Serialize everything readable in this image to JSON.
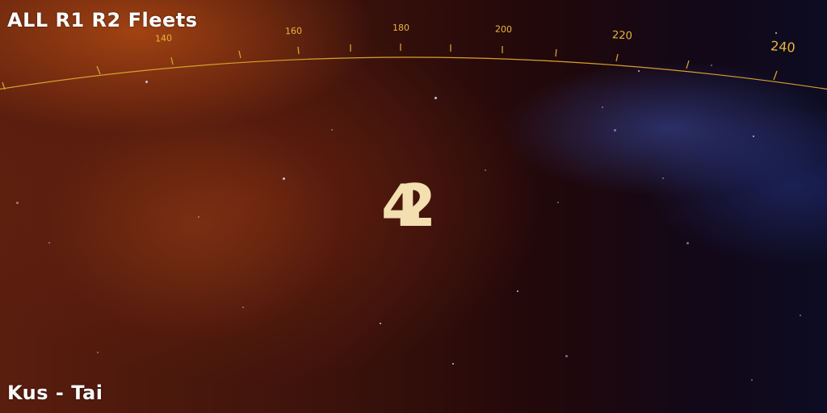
{
  "hud": {
    "fleet_title": "ALL R1  R2 Fleets",
    "location": "Kus - Tai"
  },
  "compass": {
    "headings": [
      "140",
      "160",
      "180",
      "200",
      "220",
      "240"
    ],
    "highlight_heading": "240",
    "color": "#e8b53a"
  },
  "fleet_marker": {
    "digits": [
      "4",
      "2"
    ],
    "color": "#f3dfb0"
  }
}
